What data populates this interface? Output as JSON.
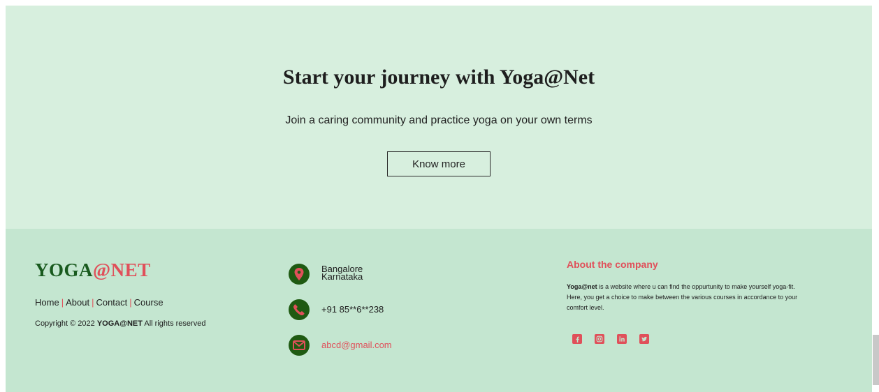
{
  "hero": {
    "title": "Start your journey with Yoga@Net",
    "subtitle": "Join a caring community and practice yoga on your own terms",
    "button": "Know more"
  },
  "footer": {
    "brand_green": "YOGA",
    "brand_red": "@NET",
    "nav": [
      "Home",
      "About",
      "Contact",
      "Course"
    ],
    "nav_sep": "|",
    "copyright_pre": "Copyright © 2022 ",
    "copyright_brand": "YOGA@NET",
    "copyright_post": " All rights reserved",
    "address_line1": "Bangalore",
    "address_line2": "Karnataka",
    "phone": "+91 85**6**238",
    "email": "abcd@gmail.com",
    "about_title": "About the company",
    "about_brand": "Yoga@net",
    "about_text": " is a website where u can find the oppurtunity to make yourself yoga-fit. Here, you get a choice to make between the various courses in accordance to your comfort level.",
    "social_icons": [
      "facebook-icon",
      "instagram-icon",
      "linkedin-icon",
      "twitter-icon"
    ]
  },
  "colors": {
    "hero_bg": "#d7efde",
    "footer_bg": "#c4e6d0",
    "brand_green": "#195a1e",
    "accent_red": "#e0505a",
    "icon_circle": "#1f5a12"
  }
}
